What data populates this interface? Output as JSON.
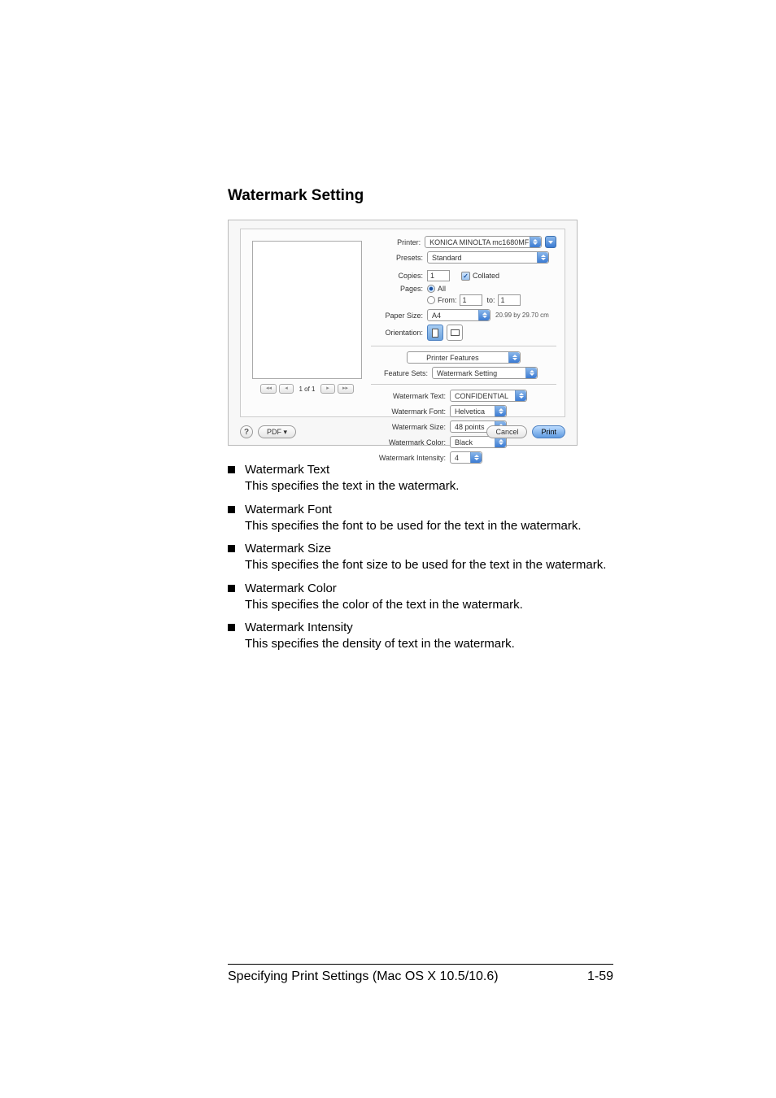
{
  "heading": "Watermark Setting",
  "dialog": {
    "printer": {
      "label": "Printer:",
      "value": "KONICA MINOLTA mc1680MF"
    },
    "presets": {
      "label": "Presets:",
      "value": "Standard"
    },
    "copies": {
      "label": "Copies:",
      "value": "1",
      "collated": "Collated"
    },
    "pages": {
      "label": "Pages:",
      "all": "All",
      "from_label": "From:",
      "from": "1",
      "to_label": "to:",
      "to": "1"
    },
    "paperSize": {
      "label": "Paper Size:",
      "value": "A4",
      "dims": "20.99 by 29.70 cm"
    },
    "orientation": {
      "label": "Orientation:"
    },
    "section": "Printer Features",
    "featureSets": {
      "label": "Feature Sets:",
      "value": "Watermark Setting"
    },
    "rows": {
      "text": {
        "label": "Watermark Text:",
        "value": "CONFIDENTIAL"
      },
      "font": {
        "label": "Watermark Font:",
        "value": "Helvetica"
      },
      "size": {
        "label": "Watermark Size:",
        "value": "48 points"
      },
      "color": {
        "label": "Watermark Color:",
        "value": "Black"
      },
      "intensity": {
        "label": "Watermark Intensity:",
        "value": "4"
      }
    },
    "nav": {
      "count": "1 of 1"
    },
    "buttons": {
      "pdf": "PDF ▾",
      "cancel": "Cancel",
      "print": "Print"
    }
  },
  "bullets": {
    "text": {
      "t": "Watermark Text",
      "d": "This specifies the text in the watermark."
    },
    "font": {
      "t": "Watermark Font",
      "d": "This specifies the font to be used for the text in the watermark."
    },
    "size": {
      "t": "Watermark Size",
      "d": "This specifies the font size to be used for the text in the watermark."
    },
    "color": {
      "t": "Watermark Color",
      "d": "This specifies the color of the text in the watermark."
    },
    "intensity": {
      "t": "Watermark Intensity",
      "d": "This specifies the density of text in the watermark."
    }
  },
  "footer": {
    "left": "Specifying Print Settings (Mac OS X 10.5/10.6)",
    "right": "1-59"
  }
}
